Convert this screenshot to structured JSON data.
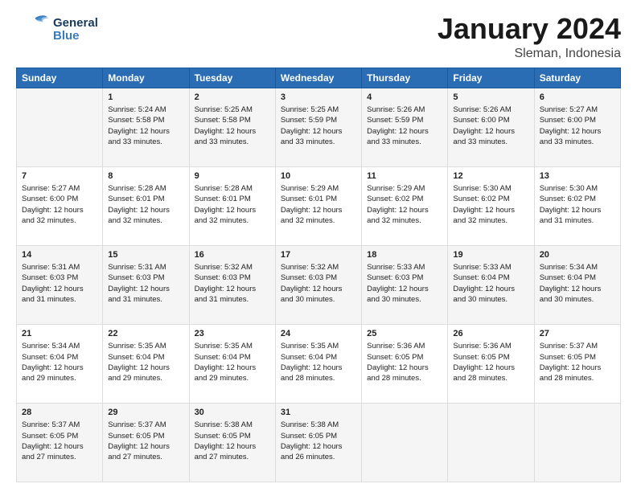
{
  "header": {
    "logo_general": "General",
    "logo_blue": "Blue",
    "title": "January 2024",
    "subtitle": "Sleman, Indonesia"
  },
  "columns": [
    "Sunday",
    "Monday",
    "Tuesday",
    "Wednesday",
    "Thursday",
    "Friday",
    "Saturday"
  ],
  "weeks": [
    {
      "cells": [
        {
          "day": "",
          "lines": []
        },
        {
          "day": "1",
          "lines": [
            "Sunrise: 5:24 AM",
            "Sunset: 5:58 PM",
            "Daylight: 12 hours",
            "and 33 minutes."
          ]
        },
        {
          "day": "2",
          "lines": [
            "Sunrise: 5:25 AM",
            "Sunset: 5:58 PM",
            "Daylight: 12 hours",
            "and 33 minutes."
          ]
        },
        {
          "day": "3",
          "lines": [
            "Sunrise: 5:25 AM",
            "Sunset: 5:59 PM",
            "Daylight: 12 hours",
            "and 33 minutes."
          ]
        },
        {
          "day": "4",
          "lines": [
            "Sunrise: 5:26 AM",
            "Sunset: 5:59 PM",
            "Daylight: 12 hours",
            "and 33 minutes."
          ]
        },
        {
          "day": "5",
          "lines": [
            "Sunrise: 5:26 AM",
            "Sunset: 6:00 PM",
            "Daylight: 12 hours",
            "and 33 minutes."
          ]
        },
        {
          "day": "6",
          "lines": [
            "Sunrise: 5:27 AM",
            "Sunset: 6:00 PM",
            "Daylight: 12 hours",
            "and 33 minutes."
          ]
        }
      ]
    },
    {
      "cells": [
        {
          "day": "7",
          "lines": [
            "Sunrise: 5:27 AM",
            "Sunset: 6:00 PM",
            "Daylight: 12 hours",
            "and 32 minutes."
          ]
        },
        {
          "day": "8",
          "lines": [
            "Sunrise: 5:28 AM",
            "Sunset: 6:01 PM",
            "Daylight: 12 hours",
            "and 32 minutes."
          ]
        },
        {
          "day": "9",
          "lines": [
            "Sunrise: 5:28 AM",
            "Sunset: 6:01 PM",
            "Daylight: 12 hours",
            "and 32 minutes."
          ]
        },
        {
          "day": "10",
          "lines": [
            "Sunrise: 5:29 AM",
            "Sunset: 6:01 PM",
            "Daylight: 12 hours",
            "and 32 minutes."
          ]
        },
        {
          "day": "11",
          "lines": [
            "Sunrise: 5:29 AM",
            "Sunset: 6:02 PM",
            "Daylight: 12 hours",
            "and 32 minutes."
          ]
        },
        {
          "day": "12",
          "lines": [
            "Sunrise: 5:30 AM",
            "Sunset: 6:02 PM",
            "Daylight: 12 hours",
            "and 32 minutes."
          ]
        },
        {
          "day": "13",
          "lines": [
            "Sunrise: 5:30 AM",
            "Sunset: 6:02 PM",
            "Daylight: 12 hours",
            "and 31 minutes."
          ]
        }
      ]
    },
    {
      "cells": [
        {
          "day": "14",
          "lines": [
            "Sunrise: 5:31 AM",
            "Sunset: 6:03 PM",
            "Daylight: 12 hours",
            "and 31 minutes."
          ]
        },
        {
          "day": "15",
          "lines": [
            "Sunrise: 5:31 AM",
            "Sunset: 6:03 PM",
            "Daylight: 12 hours",
            "and 31 minutes."
          ]
        },
        {
          "day": "16",
          "lines": [
            "Sunrise: 5:32 AM",
            "Sunset: 6:03 PM",
            "Daylight: 12 hours",
            "and 31 minutes."
          ]
        },
        {
          "day": "17",
          "lines": [
            "Sunrise: 5:32 AM",
            "Sunset: 6:03 PM",
            "Daylight: 12 hours",
            "and 30 minutes."
          ]
        },
        {
          "day": "18",
          "lines": [
            "Sunrise: 5:33 AM",
            "Sunset: 6:03 PM",
            "Daylight: 12 hours",
            "and 30 minutes."
          ]
        },
        {
          "day": "19",
          "lines": [
            "Sunrise: 5:33 AM",
            "Sunset: 6:04 PM",
            "Daylight: 12 hours",
            "and 30 minutes."
          ]
        },
        {
          "day": "20",
          "lines": [
            "Sunrise: 5:34 AM",
            "Sunset: 6:04 PM",
            "Daylight: 12 hours",
            "and 30 minutes."
          ]
        }
      ]
    },
    {
      "cells": [
        {
          "day": "21",
          "lines": [
            "Sunrise: 5:34 AM",
            "Sunset: 6:04 PM",
            "Daylight: 12 hours",
            "and 29 minutes."
          ]
        },
        {
          "day": "22",
          "lines": [
            "Sunrise: 5:35 AM",
            "Sunset: 6:04 PM",
            "Daylight: 12 hours",
            "and 29 minutes."
          ]
        },
        {
          "day": "23",
          "lines": [
            "Sunrise: 5:35 AM",
            "Sunset: 6:04 PM",
            "Daylight: 12 hours",
            "and 29 minutes."
          ]
        },
        {
          "day": "24",
          "lines": [
            "Sunrise: 5:35 AM",
            "Sunset: 6:04 PM",
            "Daylight: 12 hours",
            "and 28 minutes."
          ]
        },
        {
          "day": "25",
          "lines": [
            "Sunrise: 5:36 AM",
            "Sunset: 6:05 PM",
            "Daylight: 12 hours",
            "and 28 minutes."
          ]
        },
        {
          "day": "26",
          "lines": [
            "Sunrise: 5:36 AM",
            "Sunset: 6:05 PM",
            "Daylight: 12 hours",
            "and 28 minutes."
          ]
        },
        {
          "day": "27",
          "lines": [
            "Sunrise: 5:37 AM",
            "Sunset: 6:05 PM",
            "Daylight: 12 hours",
            "and 28 minutes."
          ]
        }
      ]
    },
    {
      "cells": [
        {
          "day": "28",
          "lines": [
            "Sunrise: 5:37 AM",
            "Sunset: 6:05 PM",
            "Daylight: 12 hours",
            "and 27 minutes."
          ]
        },
        {
          "day": "29",
          "lines": [
            "Sunrise: 5:37 AM",
            "Sunset: 6:05 PM",
            "Daylight: 12 hours",
            "and 27 minutes."
          ]
        },
        {
          "day": "30",
          "lines": [
            "Sunrise: 5:38 AM",
            "Sunset: 6:05 PM",
            "Daylight: 12 hours",
            "and 27 minutes."
          ]
        },
        {
          "day": "31",
          "lines": [
            "Sunrise: 5:38 AM",
            "Sunset: 6:05 PM",
            "Daylight: 12 hours",
            "and 26 minutes."
          ]
        },
        {
          "day": "",
          "lines": []
        },
        {
          "day": "",
          "lines": []
        },
        {
          "day": "",
          "lines": []
        }
      ]
    }
  ]
}
